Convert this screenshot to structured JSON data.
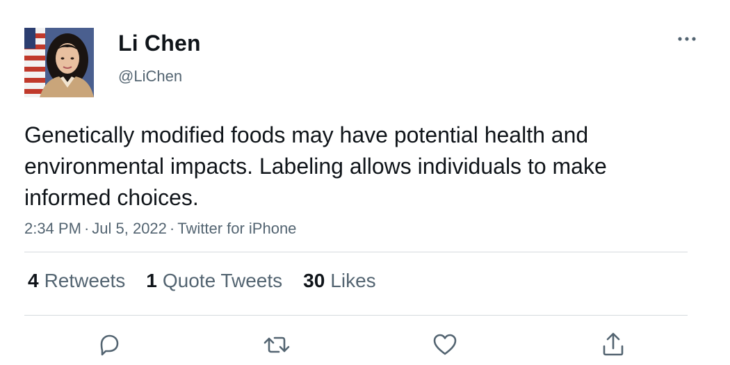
{
  "author": {
    "display_name": "Li Chen",
    "handle": "@LiChen",
    "avatar_icon": "profile-photo"
  },
  "tweet": {
    "text": "Genetically modified foods may have potential health and environmental impacts. Labeling allows individuals to make informed choices.",
    "time": "2:34 PM",
    "date": "Jul 5, 2022",
    "source": "Twitter for iPhone",
    "separator": "·"
  },
  "stats": {
    "retweets_count": "4",
    "retweets_label": "Retweets",
    "quotes_count": "1",
    "quotes_label": "Quote Tweets",
    "likes_count": "30",
    "likes_label": "Likes"
  },
  "actions": {
    "reply_icon": "reply-icon",
    "retweet_icon": "retweet-icon",
    "like_icon": "heart-icon",
    "share_icon": "share-icon",
    "more_icon": "more-icon"
  },
  "colors": {
    "text_primary": "#0f1419",
    "text_secondary": "#536471",
    "divider": "#d4d9dd"
  }
}
